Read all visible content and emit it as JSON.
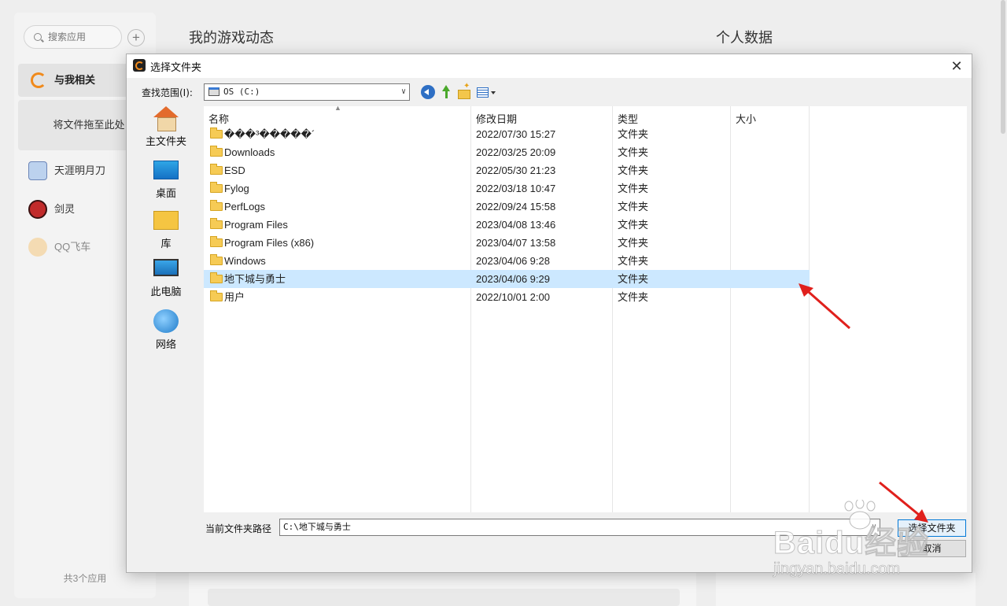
{
  "background": {
    "sidebar": {
      "search_placeholder": "搜索应用",
      "add_symbol": "+",
      "nav_related": "与我相关",
      "drop_zone": "将文件拖至此处",
      "games": [
        "天涯明月刀",
        "剑灵",
        "QQ飞车"
      ],
      "app_count": "共3个应用"
    },
    "main_title": "我的游戏动态",
    "right_title": "个人数据"
  },
  "dialog": {
    "title": "选择文件夹",
    "close_symbol": "✕",
    "look_in_label": "查找范围(I):",
    "look_in_value": "OS (C:)",
    "places": [
      "主文件夹",
      "桌面",
      "库",
      "此电脑",
      "网络"
    ],
    "columns": {
      "name": "名称",
      "date": "修改日期",
      "type": "类型",
      "size": "大小"
    },
    "files": [
      {
        "name": "���³�����´",
        "date": "2022/07/30 15:27",
        "type": "文件夹"
      },
      {
        "name": "Downloads",
        "date": "2022/03/25 20:09",
        "type": "文件夹"
      },
      {
        "name": "ESD",
        "date": "2022/05/30 21:23",
        "type": "文件夹"
      },
      {
        "name": "Fylog",
        "date": "2022/03/18 10:47",
        "type": "文件夹"
      },
      {
        "name": "PerfLogs",
        "date": "2022/09/24 15:58",
        "type": "文件夹"
      },
      {
        "name": "Program Files",
        "date": "2023/04/08 13:46",
        "type": "文件夹"
      },
      {
        "name": "Program Files (x86)",
        "date": "2023/04/07 13:58",
        "type": "文件夹"
      },
      {
        "name": "Windows",
        "date": "2023/04/06 9:28",
        "type": "文件夹"
      },
      {
        "name": "地下城与勇士",
        "date": "2023/04/06 9:29",
        "type": "文件夹",
        "selected": true
      },
      {
        "name": "用户",
        "date": "2022/10/01 2:00",
        "type": "文件夹"
      }
    ],
    "path_label": "当前文件夹路径",
    "path_value": "C:\\地下城与勇士",
    "select_button": "选择文件夹",
    "cancel_button": "取消"
  },
  "watermark": {
    "main": "Baidu经验",
    "url": "jingyan.baidu.com"
  },
  "colors": {
    "accent": "#f08a1c",
    "selection": "#cce8ff",
    "annotation_arrow": "#e0201c"
  }
}
